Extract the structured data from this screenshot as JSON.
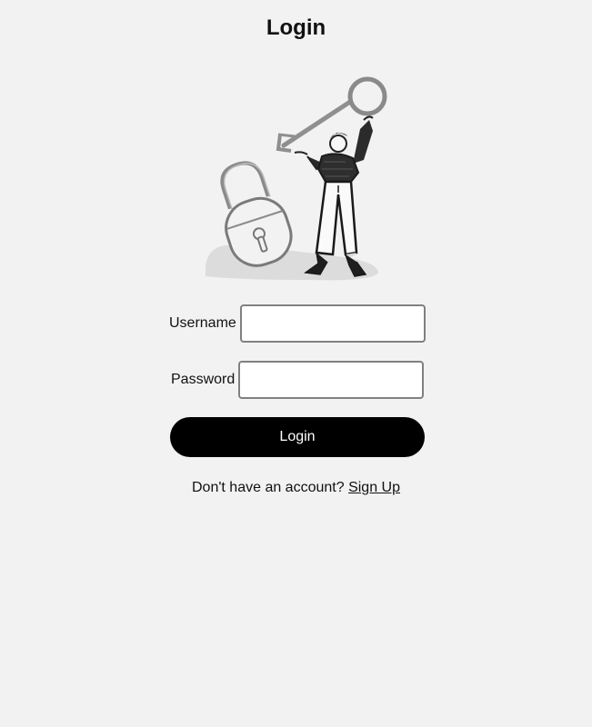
{
  "page": {
    "title": "Login"
  },
  "illustration": {
    "description_icon": "person-holding-key-next-to-padlock-illustration"
  },
  "form": {
    "username_label": "Username",
    "username_value": "",
    "password_label": "Password",
    "password_value": "",
    "submit_label": "Login"
  },
  "signup": {
    "prompt": "Don't have an account?",
    "link_label": "Sign Up"
  },
  "colors": {
    "background": "#f2f2f2",
    "button": "#000000",
    "button_text": "#ffffff",
    "input_border": "#808080"
  }
}
